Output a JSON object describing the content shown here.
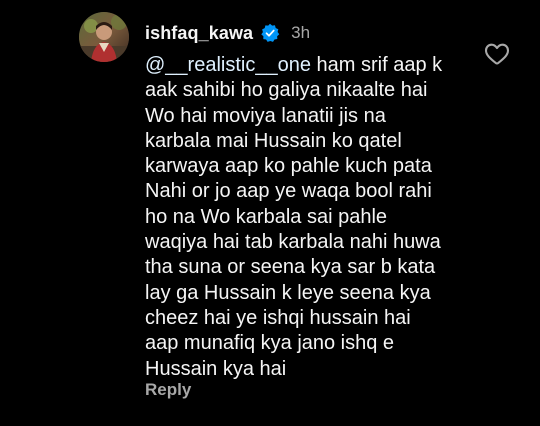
{
  "comment": {
    "username": "ishfaq_kawa",
    "timestamp": "3h",
    "mention": "@__realistic__one",
    "text_lines": [
      " ham srif aap k",
      "aak sahibi ho galiya nikaalte hai",
      "Wo hai moviya lanatii jis na",
      "karbala mai Hussain ko qatel",
      "karwaya aap ko pahle kuch pata",
      "Nahi or jo aap ye waqa bool rahi",
      "ho na Wo karbala sai pahle",
      "waqiya hai tab karbala nahi huwa",
      "tha suna or seena kya sar b kata",
      "lay ga Hussain k leye seena kya",
      "cheez hai ye ishqi hussain hai",
      "aap munafiq kya jano ishq e",
      "Hussain kya hai"
    ],
    "reply_label": "Reply",
    "icons": {
      "avatar": "avatar",
      "verified": "verified-badge-icon",
      "like": "heart-outline-icon"
    }
  },
  "colors": {
    "background": "#000000",
    "text": "#f5f5f5",
    "muted": "#a8a8a8",
    "verified": "#0095f6",
    "mention": "#e0f1ff"
  }
}
